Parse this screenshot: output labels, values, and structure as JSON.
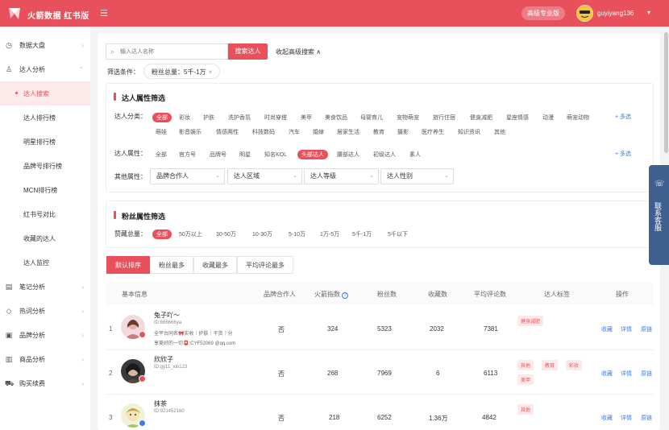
{
  "header": {
    "brand": "火箭数据 红书版",
    "collapse_icon": "☰",
    "pro_button": "高级专业版",
    "username": "guyiyang136",
    "caret": "▾"
  },
  "sidebar": {
    "items": [
      {
        "label": "数据大盘",
        "icon": "◷",
        "arrow": "›"
      },
      {
        "label": "达人分析",
        "icon": "♙",
        "arrow": "⌃"
      },
      {
        "label": "达人搜索"
      },
      {
        "label": "达人排行榜"
      },
      {
        "label": "明星排行榜"
      },
      {
        "label": "品牌号排行榜"
      },
      {
        "label": "MCN排行榜"
      },
      {
        "label": "红书号对比"
      },
      {
        "label": "收藏的达人"
      },
      {
        "label": "达人监控"
      },
      {
        "label": "笔记分析",
        "icon": "▤",
        "arrow": "›"
      },
      {
        "label": "热词分析",
        "icon": "◇",
        "arrow": "›"
      },
      {
        "label": "品牌分析",
        "icon": "▣",
        "arrow": "›"
      },
      {
        "label": "商品分析",
        "icon": "▥",
        "arrow": "›"
      },
      {
        "label": "购买续费",
        "icon": "⛟",
        "arrow": "›"
      }
    ]
  },
  "search": {
    "placeholder": "输入达人名称",
    "button": "搜索达人",
    "adv_toggle": "收起高级搜索 ∧",
    "icon": "⌕"
  },
  "filter_condition": {
    "label": "筛选条件：",
    "tag": "粉丝总量：5千-1万",
    "remove": "×"
  },
  "talent_section": {
    "title": "达人属性筛选",
    "category_label": "达人分类：",
    "categories_row1": [
      "全部",
      "彩妆",
      "护肤",
      "洗护香氛",
      "时尚穿搭",
      "美甲",
      "美食饮品",
      "母婴育儿",
      "宠物萌宠",
      "旅行住宿",
      "健身减肥",
      "星座情感",
      "动漫",
      "萌宠动物"
    ],
    "categories_row2": [
      "萌娃",
      "影音娱乐",
      "情感两性",
      "科技数码",
      "汽车",
      "婚嫁",
      "居家生活",
      "教育",
      "摄影",
      "医疗养生",
      "知识资讯",
      "其他"
    ],
    "attr_label": "达人属性：",
    "attrs": [
      "全部",
      "官方号",
      "品牌号",
      "明星",
      "知名KOL",
      "头部达人",
      "腰部达人",
      "初级达人",
      "素人"
    ],
    "more": "+ 多选",
    "other_label": "其他属性：",
    "selects": [
      "品牌合作人",
      "达人区域",
      "达人等级",
      "达人性别"
    ],
    "select_arrow": "⌄"
  },
  "fans_section": {
    "title": "粉丝属性筛选",
    "label": "赞藏总量：",
    "options": [
      "全部",
      "50万以上",
      "30-50万",
      "10-30万",
      "5-10万",
      "1万-5万",
      "5千-1万",
      "5千以下"
    ]
  },
  "sort_tabs": [
    "默认排序",
    "粉丝最多",
    "收藏最多",
    "平均评论最多"
  ],
  "table": {
    "headers": [
      "基本信息",
      "品牌合作人",
      "火箭指数",
      "粉丝数",
      "收藏数",
      "平均评论数",
      "达人标签",
      "操作"
    ],
    "help_icon": "?",
    "rows": [
      {
        "index": "1",
        "name": "兔子吖～",
        "id": "ID:666666ya",
        "desc": "全平台同名🎀实收｜护肤｜干货｜分",
        "desc2": "享美好的一切📮:CYF52069 @qq.com",
        "brand": "否",
        "rocket": "324",
        "fans": "5323",
        "collect": "2032",
        "comment": "7381",
        "tags": [
          "健身减肥"
        ],
        "ops": [
          "收藏",
          "详情",
          "原链"
        ]
      },
      {
        "index": "2",
        "name": "欣欣子",
        "id": "ID:gy11_xin123",
        "desc": "",
        "desc2": "",
        "brand": "否",
        "rocket": "268",
        "fans": "7969",
        "collect": "6",
        "comment": "6113",
        "tags": [
          "其他",
          "教育",
          "彩妆",
          "美甲"
        ],
        "ops": [
          "收藏",
          "详情",
          "原链"
        ]
      },
      {
        "index": "3",
        "name": "抹茶",
        "id": "ID:921452160",
        "desc": "",
        "desc2": "",
        "brand": "否",
        "rocket": "218",
        "fans": "6252",
        "collect": "1.36万",
        "comment": "4842",
        "tags": [
          "其他"
        ],
        "ops": [
          "收藏",
          "详情",
          "原链"
        ]
      }
    ]
  },
  "float_service": {
    "icon": "☏",
    "label": "联系客服"
  },
  "colors": {
    "accent": "#e8505b",
    "link": "#3b7be6",
    "service": "#3f5f8e"
  }
}
